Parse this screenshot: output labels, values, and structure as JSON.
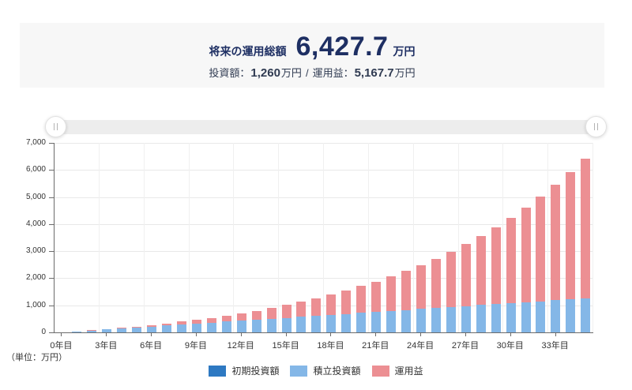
{
  "summary": {
    "title": "将来の運用総額",
    "total_value": "6,427.7",
    "total_unit": "万円",
    "invest_label": "投資額：",
    "invest_value": "1,260",
    "invest_unit": "万円",
    "separator": "/",
    "profit_label": "運用益：",
    "profit_value": "5,167.7",
    "profit_unit": "万円"
  },
  "slider": {
    "handle_icon": "grip-vertical"
  },
  "colors": {
    "summary_navy": "#1e2f63",
    "initial_investment": "#2e79c2",
    "accumulated_investment": "#84b7e7",
    "profit": "#ec8f93"
  },
  "chart_data": {
    "type": "bar",
    "stacked": true,
    "unit_note": "（単位：万円）",
    "ylim": [
      0,
      7000
    ],
    "grid": true,
    "legend_position": "bottom",
    "y_ticks": [
      {
        "value": 0,
        "label": "0"
      },
      {
        "value": 1000,
        "label": "1,000"
      },
      {
        "value": 2000,
        "label": "2,000"
      },
      {
        "value": 3000,
        "label": "3,000"
      },
      {
        "value": 4000,
        "label": "4,000"
      },
      {
        "value": 5000,
        "label": "5,000"
      },
      {
        "value": 6000,
        "label": "6,000"
      },
      {
        "value": 7000,
        "label": "7,000"
      }
    ],
    "x_ticks": [
      {
        "band": 0,
        "label": "0年目"
      },
      {
        "band": 3,
        "label": "3年目"
      },
      {
        "band": 6,
        "label": "6年目"
      },
      {
        "band": 9,
        "label": "9年目"
      },
      {
        "band": 12,
        "label": "12年目"
      },
      {
        "band": 15,
        "label": "15年目"
      },
      {
        "band": 18,
        "label": "18年目"
      },
      {
        "band": 21,
        "label": "21年目"
      },
      {
        "band": 24,
        "label": "24年目"
      },
      {
        "band": 27,
        "label": "27年目"
      },
      {
        "band": 30,
        "label": "30年目"
      },
      {
        "band": 33,
        "label": "33年目"
      }
    ],
    "bands": 36,
    "series": [
      {
        "name": "初期投資額",
        "color": "#2e79c2",
        "values": [
          0,
          0,
          0,
          0,
          0,
          0,
          0,
          0,
          0,
          0,
          0,
          0,
          0,
          0,
          0,
          0,
          0,
          0,
          0,
          0,
          0,
          0,
          0,
          0,
          0,
          0,
          0,
          0,
          0,
          0,
          0,
          0,
          0,
          0,
          0,
          0
        ]
      },
      {
        "name": "積立投資額",
        "color": "#84b7e7",
        "values": [
          0,
          36,
          72,
          108,
          144,
          180,
          216,
          252,
          288,
          324,
          360,
          396,
          432,
          468,
          504,
          540,
          576,
          612,
          648,
          684,
          720,
          756,
          792,
          828,
          864,
          900,
          936,
          972,
          1008,
          1044,
          1080,
          1116,
          1152,
          1188,
          1224,
          1260
        ]
      },
      {
        "name": "運用益",
        "color": "#ec8f93",
        "values": [
          0,
          1.3,
          5.6,
          13.1,
          24.1,
          38.9,
          57.7,
          80.9,
          108.8,
          141.9,
          180.4,
          225.0,
          276.0,
          333.9,
          399.4,
          472.9,
          555.3,
          647.1,
          749.1,
          862.2,
          987.2,
          1125.1,
          1276.9,
          1443.7,
          1626.7,
          1827.3,
          2046.8,
          2286.7,
          2548.7,
          2834.6,
          3146.1,
          3485.5,
          3854.9,
          4256.8,
          4693.7,
          5167.7
        ]
      }
    ]
  }
}
